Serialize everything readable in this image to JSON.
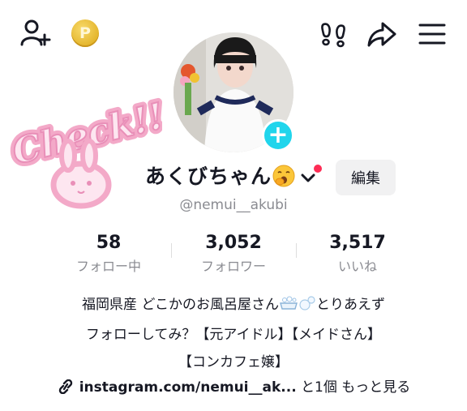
{
  "top_bar": {
    "icons": [
      "add-user-icon",
      "coin-icon",
      "footprint-icon",
      "share-icon",
      "menu-icon"
    ],
    "coin_letter": "P"
  },
  "profile": {
    "display_name": "あくびちゃん",
    "name_emoji": "yawning-face",
    "username": "@nemui__akubi",
    "edit_label": "編集",
    "sticker_text": "Check!!"
  },
  "stats": [
    {
      "value": "58",
      "label": "フォロー中"
    },
    {
      "value": "3,052",
      "label": "フォロワー"
    },
    {
      "value": "3,517",
      "label": "いいね"
    }
  ],
  "bio": {
    "line1_before": "福岡県産 どこかのお風呂屋さん",
    "line1_after": "とりあえず",
    "line2": "フォローしてみ？【元アイドル】【メイドさん】",
    "line3": "【コンカフェ嬢】"
  },
  "link": {
    "url_text": "instagram.com/nemui__ak...",
    "extra": "と1個",
    "more": "もっと見る"
  },
  "colors": {
    "accent_cyan": "#20d5ec",
    "notification_red": "#fe2c55",
    "secondary_text": "#8a8b91",
    "sticker_pink": "#f7b6d2"
  }
}
